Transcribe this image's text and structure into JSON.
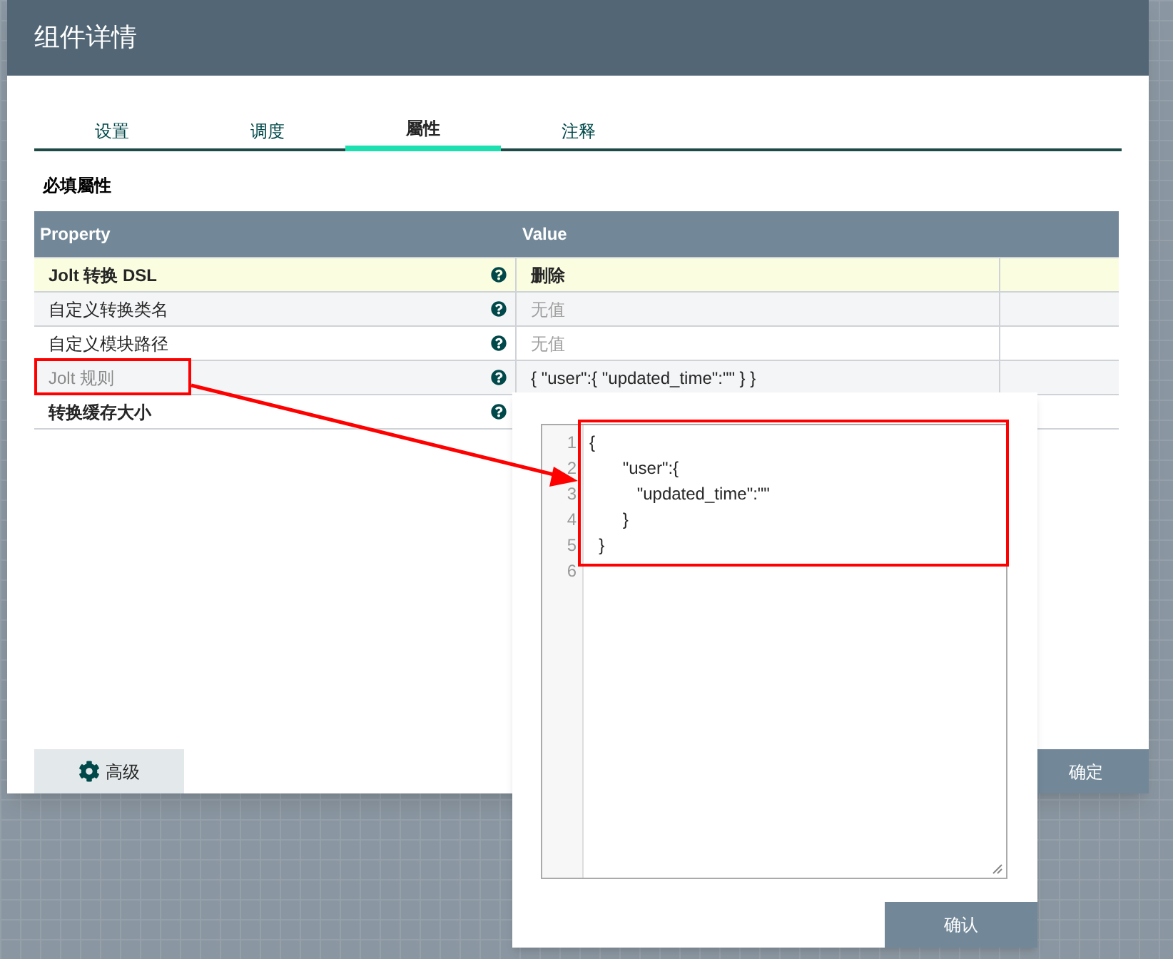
{
  "dialog": {
    "title": "组件详情",
    "tabs": [
      {
        "label": "设置",
        "selected": false
      },
      {
        "label": "调度",
        "selected": false
      },
      {
        "label": "屬性",
        "selected": true
      },
      {
        "label": "注释",
        "selected": false
      }
    ],
    "section_title": "必填屬性",
    "table": {
      "columns": [
        "Property",
        "Value"
      ],
      "rows": [
        {
          "name": "Jolt 转换 DSL",
          "required": true,
          "selected": true,
          "dimmed": false,
          "value": "删除",
          "kind": "value"
        },
        {
          "name": "自定义转换类名",
          "required": false,
          "selected": false,
          "dimmed": false,
          "value": "无值",
          "kind": "empty"
        },
        {
          "name": "自定义模块路径",
          "required": false,
          "selected": false,
          "dimmed": false,
          "value": "无值",
          "kind": "empty"
        },
        {
          "name": "Jolt 规则",
          "required": false,
          "selected": false,
          "dimmed": true,
          "value": "{ \"user\":{ \"updated_time\":\"\" } }",
          "kind": "text"
        },
        {
          "name": "转换缓存大小",
          "required": true,
          "selected": false,
          "dimmed": false,
          "kind": "hidden"
        }
      ]
    },
    "advanced_button": "高级",
    "ok_button": "确定"
  },
  "editor": {
    "line_numbers": [
      "1",
      "2",
      "3",
      "4",
      "5",
      "6"
    ],
    "lines": [
      "{",
      "       \"user\":{",
      "          \"updated_time\":\"\"",
      "       }",
      "  }"
    ],
    "confirm_button": "确认"
  }
}
